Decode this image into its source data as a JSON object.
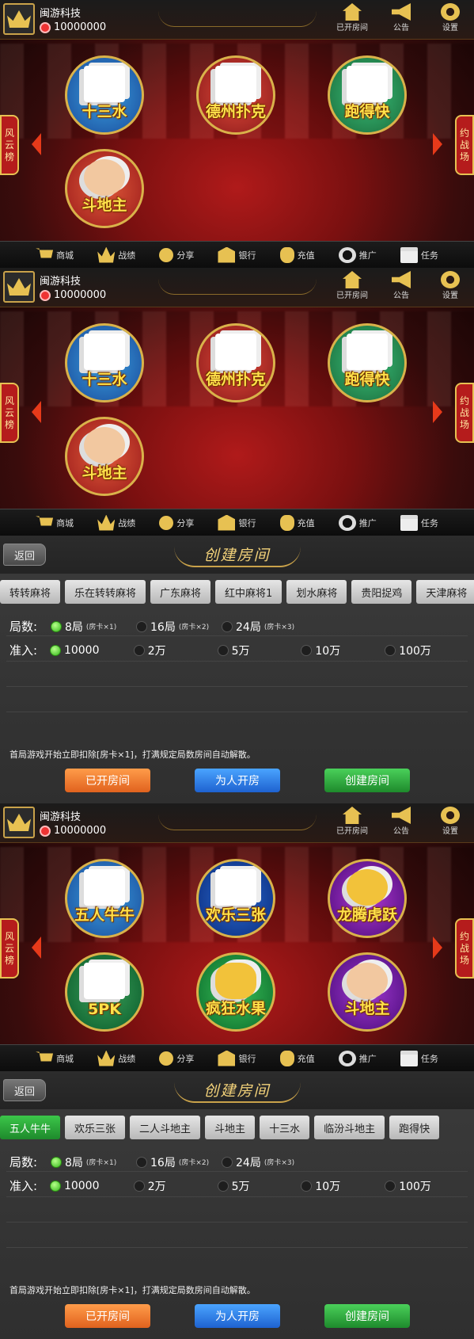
{
  "lobby1": {
    "company": "闽游科技",
    "coins": "10000000",
    "top_icons": [
      {
        "label": "已开房间",
        "icon": "house-icon"
      },
      {
        "label": "公告",
        "icon": "megaphone-icon"
      },
      {
        "label": "设置",
        "icon": "gear-icon"
      }
    ],
    "left_side": "风云榜",
    "right_side": "约战场",
    "games": [
      "十三水",
      "德州扑克",
      "跑得快",
      "斗地主"
    ],
    "bottom_nav": [
      "商城",
      "战绩",
      "分享",
      "银行",
      "充值",
      "推广",
      "任务"
    ]
  },
  "lobby2": {
    "company": "闽游科技",
    "coins": "10000000",
    "top_icons": [
      {
        "label": "已开房间"
      },
      {
        "label": "公告"
      },
      {
        "label": "设置"
      }
    ],
    "left_side": "风云榜",
    "right_side": "约战场",
    "games": [
      "十三水",
      "德州扑克",
      "跑得快",
      "斗地主"
    ],
    "bottom_nav": [
      "商城",
      "战绩",
      "分享",
      "银行",
      "充值",
      "推广",
      "任务"
    ]
  },
  "room1": {
    "back": "返回",
    "title": "创建房间",
    "tabs": [
      "转转麻将",
      "乐在转转麻将",
      "广东麻将",
      "红中麻将1",
      "划水麻将",
      "贵阳捉鸡",
      "天津麻将"
    ],
    "rounds_label": "局数:",
    "rounds": [
      {
        "main": "8局",
        "sub": "(房卡×1)",
        "on": true
      },
      {
        "main": "16局",
        "sub": "(房卡×2)"
      },
      {
        "main": "24局",
        "sub": "(房卡×3)"
      }
    ],
    "entry_label": "准入:",
    "entry": [
      "10000",
      "2万",
      "5万",
      "10万",
      "100万"
    ],
    "note": "首局游戏开始立即扣除[房卡×1]，打满规定局数房间自动解散。",
    "btn_opened": "已开房间",
    "btn_for_others": "为人开房",
    "btn_create": "创建房间"
  },
  "lobby3": {
    "company": "闽游科技",
    "coins": "10000000",
    "top_icons": [
      {
        "label": "已开房间"
      },
      {
        "label": "公告"
      },
      {
        "label": "设置"
      }
    ],
    "left_side": "风云榜",
    "right_side": "约战场",
    "games": [
      "五人牛牛",
      "欢乐三张",
      "龙腾虎跃",
      "5PK",
      "疯狂水果",
      "斗地主"
    ],
    "bottom_nav": [
      "商城",
      "战绩",
      "分享",
      "银行",
      "充值",
      "推广",
      "任务"
    ]
  },
  "room2": {
    "back": "返回",
    "title": "创建房间",
    "tabs": [
      "五人牛牛",
      "欢乐三张",
      "二人斗地主",
      "斗地主",
      "十三水",
      "临汾斗地主",
      "跑得快"
    ],
    "rounds_label": "局数:",
    "rounds": [
      {
        "main": "8局",
        "sub": "(房卡×1)",
        "on": true
      },
      {
        "main": "16局",
        "sub": "(房卡×2)"
      },
      {
        "main": "24局",
        "sub": "(房卡×3)"
      }
    ],
    "entry_label": "准入:",
    "entry": [
      "10000",
      "2万",
      "5万",
      "10万",
      "100万"
    ],
    "note": "首局游戏开始立即扣除[房卡×1]，打满规定局数房间自动解散。",
    "btn_opened": "已开房间",
    "btn_for_others": "为人开房",
    "btn_create": "创建房间"
  }
}
